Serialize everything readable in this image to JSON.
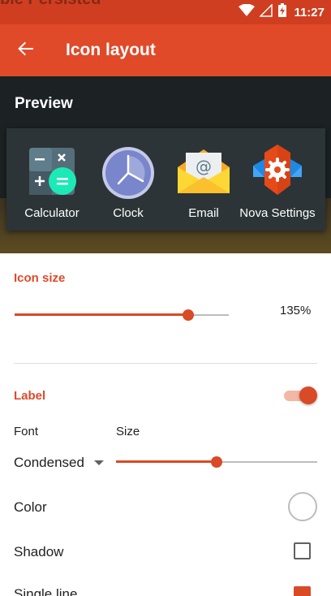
{
  "status_bar": {
    "time": "11:27",
    "ghost_text": "ble Persisted",
    "icons": [
      "wifi-icon",
      "signal-icon",
      "battery-charging-icon"
    ]
  },
  "app_bar": {
    "title": "Icon layout",
    "back_icon": "arrow-back-icon"
  },
  "preview": {
    "title": "Preview",
    "apps": [
      {
        "label": "Calculator",
        "icon": "calculator-icon"
      },
      {
        "label": "Clock",
        "icon": "clock-icon"
      },
      {
        "label": "Email",
        "icon": "email-icon"
      },
      {
        "label": "Nova Settings",
        "icon": "nova-settings-icon"
      }
    ]
  },
  "settings": {
    "icon_size": {
      "header": "Icon size",
      "value_text": "135%",
      "slider_fraction": 0.81
    },
    "label": {
      "header": "Label",
      "enabled": true,
      "font_label": "Font",
      "size_label": "Size",
      "font_value": "Condensed",
      "size_slider_fraction": 0.5,
      "color_label": "Color",
      "shadow_label": "Shadow",
      "shadow_checked": false,
      "single_line_label": "Single line",
      "single_line_checked": true
    }
  },
  "colors": {
    "accent": "#e04a29",
    "status_bar": "#cf3e20",
    "preview_bg": "#1c2123",
    "dock_bg": "#2c3437"
  }
}
